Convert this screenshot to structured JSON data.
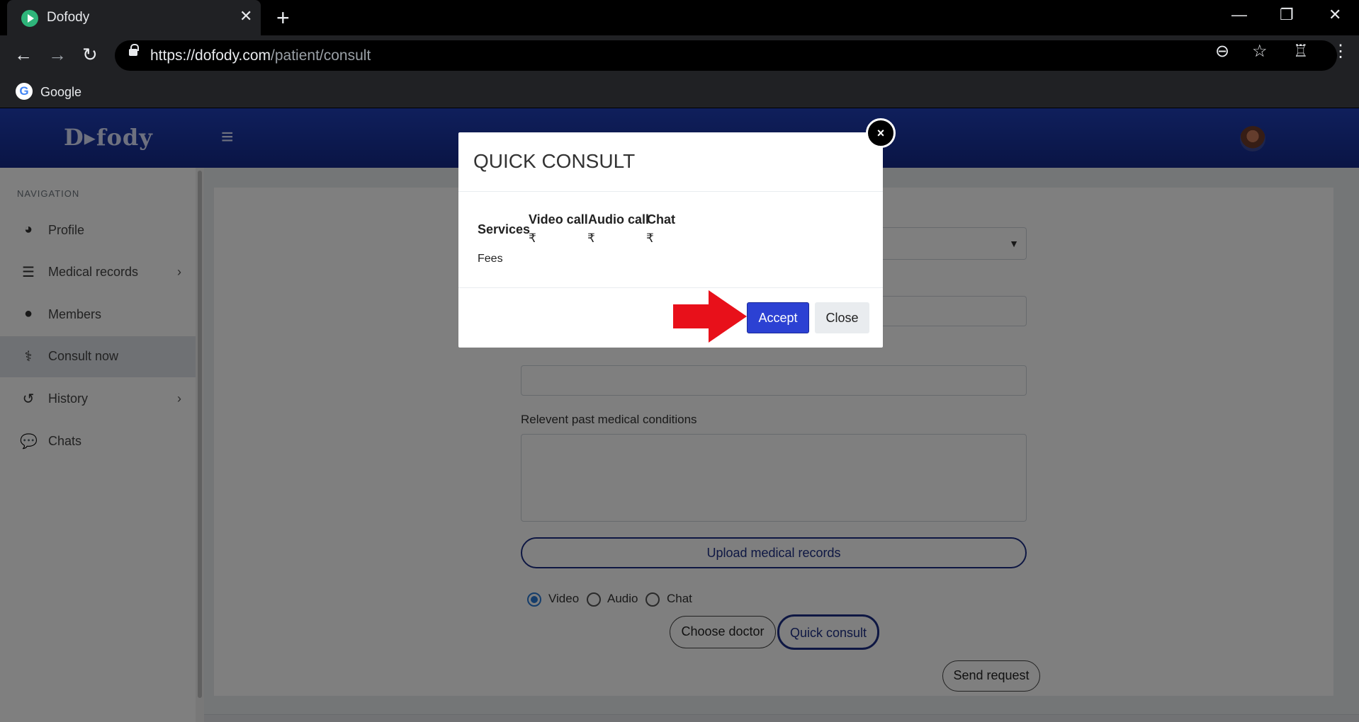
{
  "browser": {
    "tab_title": "Dofody",
    "tab_close": "✕",
    "new_tab": "+",
    "window_controls": [
      "—",
      "❐",
      "✕"
    ],
    "url_domain": "https://dofody.com",
    "url_path": "/patient/consult",
    "bookmark_label": "Google"
  },
  "app": {
    "logo": "D▸fody",
    "hamburger": "≡",
    "nav_title": "NAVIGATION",
    "nav_items": [
      {
        "label": "Profile",
        "icon": "dashboard-icon"
      },
      {
        "label": "Medical records",
        "icon": "list-icon",
        "arrow": "›"
      },
      {
        "label": "Members",
        "icon": "user-icon"
      },
      {
        "label": "Consult now",
        "icon": "stethoscope-icon"
      },
      {
        "label": "History",
        "icon": "history-icon",
        "arrow": "›"
      },
      {
        "label": "Chats",
        "icon": "chat-icon"
      }
    ],
    "form": {
      "past_conditions_label": "Relevent past medical conditions",
      "upload_button": "Upload medical records",
      "radio_options": [
        "Video",
        "Audio",
        "Chat"
      ],
      "choose_doctor_button": "Choose doctor",
      "quick_consult_button": "Quick consult",
      "send_request_button": "Send request"
    }
  },
  "modal": {
    "title": "QUICK CONSULT",
    "row_labels": [
      "Services",
      "Fees"
    ],
    "columns": [
      "Video call",
      "Audio call",
      "Chat"
    ],
    "fees": [
      "₹",
      "₹",
      "₹"
    ],
    "accept_button": "Accept",
    "close_button": "Close",
    "dismiss": "×"
  },
  "colors": {
    "accent": "#2c41d3",
    "header": "#1f3fb8",
    "annotation_arrow": "#e8101a"
  }
}
